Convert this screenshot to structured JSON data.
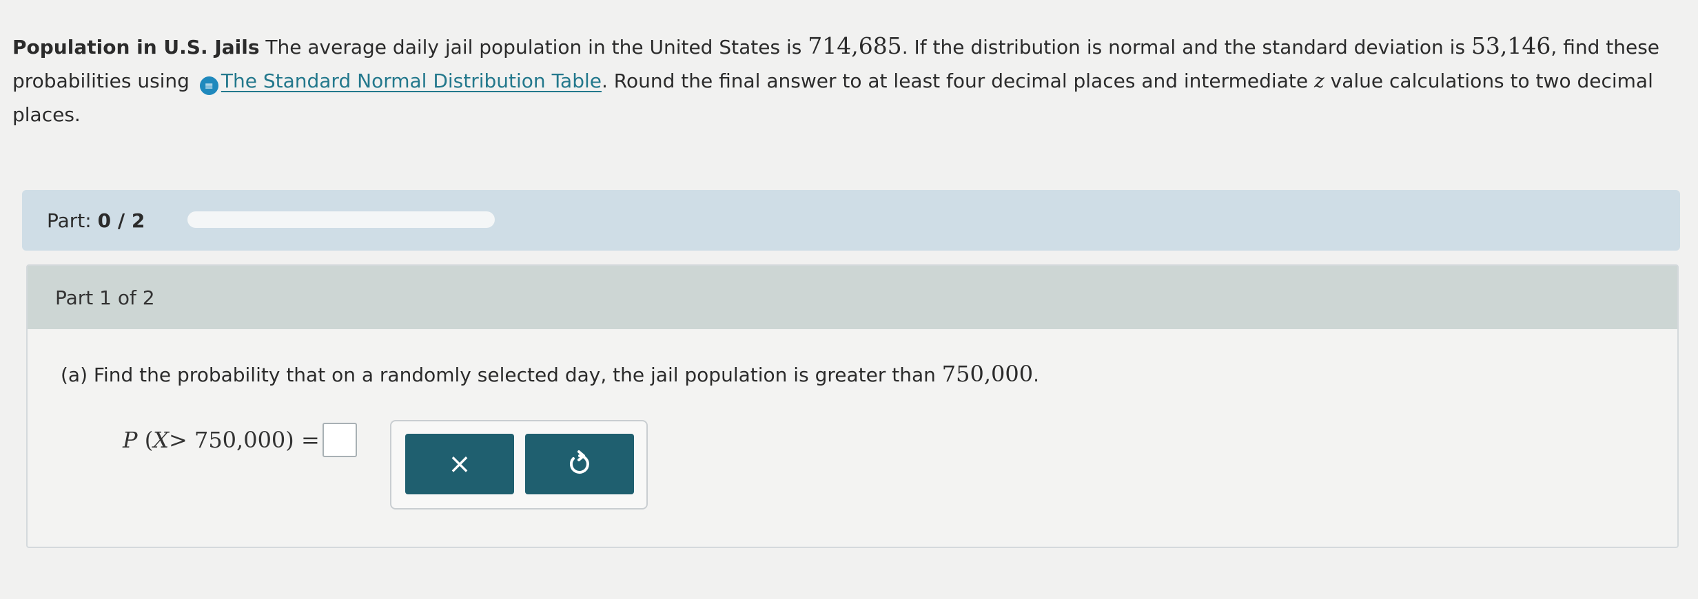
{
  "problem": {
    "title": "Population in U.S. Jails",
    "text_1": " The average daily jail population in the United States is ",
    "mean": "714,685",
    "text_2": ". If the distribution is normal and the standard deviation is ",
    "std_dev": "53,146",
    "text_3": ", find these probabilities using ",
    "link_label": "The Standard Normal Distribution Table",
    "text_4": ". Round the final answer to at least four decimal places and intermediate ",
    "z_symbol": "z",
    "text_5": " value calculations to two decimal places."
  },
  "progress": {
    "label": "Part: ",
    "count": "0 / 2",
    "fraction": 0
  },
  "part": {
    "header": "Part 1 of 2",
    "question_text": "(a) Find the probability that on a randomly selected day, the jail population is greater than ",
    "threshold": "750,000",
    "question_end": ".",
    "equation": {
      "prefix": "P",
      "open": " (",
      "variable": "X",
      "relation": "> 750,000",
      "close": ") ="
    }
  },
  "tools": {
    "clear_label": "×"
  },
  "icons": {
    "link_icon": "link-icon",
    "undo_icon": "undo-icon"
  },
  "colors": {
    "accent": "#1f5f6f",
    "link": "#23788c",
    "part_bar": "#cfdde6",
    "part_header": "#cdd6d4"
  }
}
